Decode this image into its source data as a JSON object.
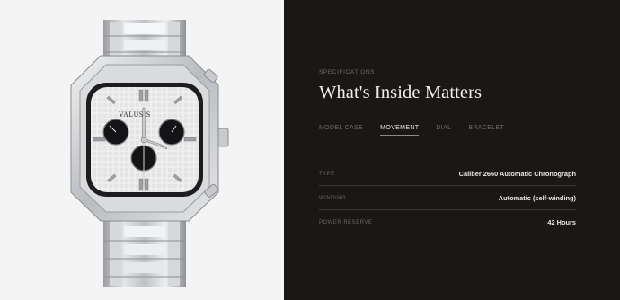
{
  "product_image": {
    "brand_on_dial": "VALUSIS"
  },
  "section": {
    "eyebrow": "SPECIFICATIONS",
    "title": "What's Inside Matters"
  },
  "tabs": [
    {
      "label": "MODEL CASE",
      "active": false
    },
    {
      "label": "MOVEMENT",
      "active": true
    },
    {
      "label": "DIAL",
      "active": false
    },
    {
      "label": "BRACELET",
      "active": false
    }
  ],
  "specs": [
    {
      "label": "TYPE",
      "value": "Caliber 2660 Automatic Chronograph"
    },
    {
      "label": "WINDING",
      "value": "Automatic (self-winding)"
    },
    {
      "label": "POWER RESERVE",
      "value": "42 Hours"
    }
  ],
  "colors": {
    "background": "#1a1817",
    "image_background": "#f4f4f4",
    "text_primary": "#f2efea",
    "text_muted": "#6f6b67",
    "divider": "#3a3633"
  }
}
